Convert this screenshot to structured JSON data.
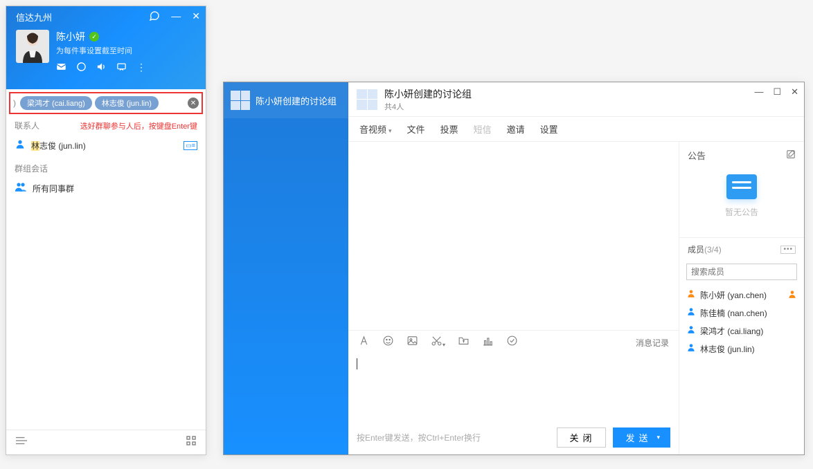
{
  "contact": {
    "app_title": "信达九州",
    "user": {
      "name": "陈小妍",
      "status_sub": "为每件事设置截至时间"
    },
    "chips": [
      {
        "label": "梁鸿才 (cai.liang)"
      },
      {
        "label": "林志俊 (jun.lin)"
      }
    ],
    "section_contacts": "联系人",
    "hint": "选好群聊参与人后，按键盘Enter键",
    "contact_item_name_prefix": "林",
    "contact_item_name_rest": "志俊 (jun.lin)",
    "section_groups": "群组会话",
    "group_item": "所有同事群"
  },
  "chat": {
    "sidebar_tab": "陈小妍创建的讨论组",
    "title": "陈小妍创建的讨论组",
    "subtitle": "共4人",
    "menu": {
      "av": "音视频",
      "file": "文件",
      "vote": "投票",
      "sms": "短信",
      "invite": "邀请",
      "settings": "设置"
    },
    "history": "消息记录",
    "input_hint": "按Enter键发送，按Ctrl+Enter换行",
    "btn_close": "关闭",
    "btn_send": "发送",
    "announce_label": "公告",
    "announce_empty": "暂无公告",
    "members_label": "成员",
    "members_count": "(3/4)",
    "member_search_ph": "搜索成员",
    "members": [
      {
        "name": "陈小妍 (yan.chen)",
        "owner": true,
        "color": "orange"
      },
      {
        "name": "陈佳楠 (nan.chen)",
        "owner": false,
        "color": "blue"
      },
      {
        "name": "梁鸿才 (cai.liang)",
        "owner": false,
        "color": "blue"
      },
      {
        "name": "林志俊 (jun.lin)",
        "owner": false,
        "color": "blue"
      }
    ]
  }
}
